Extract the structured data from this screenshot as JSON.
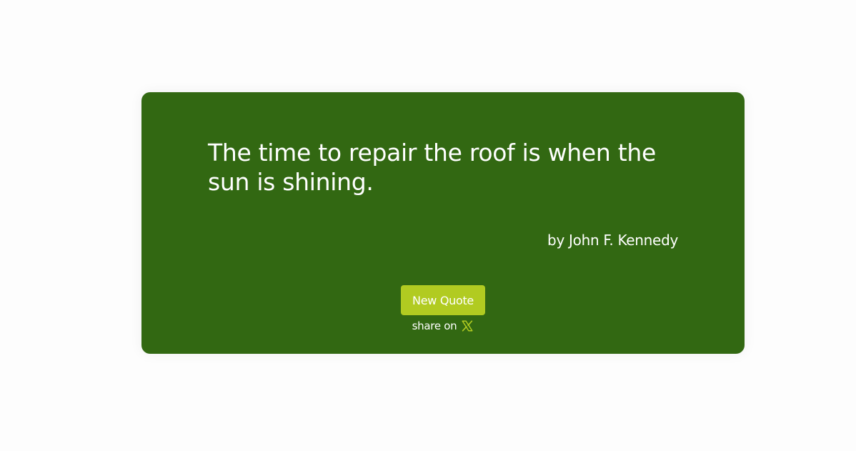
{
  "quote": {
    "text": "The time to repair the roof is when the sun is shining.",
    "author": "by John F. Kennedy"
  },
  "actions": {
    "new_quote_label": "New Quote",
    "share_label": "share on",
    "share_icon": "x-logo-icon"
  },
  "colors": {
    "page_background": "#fdfdfd",
    "card_background": "#326812",
    "button_background": "#b1cb21",
    "x_icon": "#b1cb21",
    "text": "#ffffff"
  }
}
